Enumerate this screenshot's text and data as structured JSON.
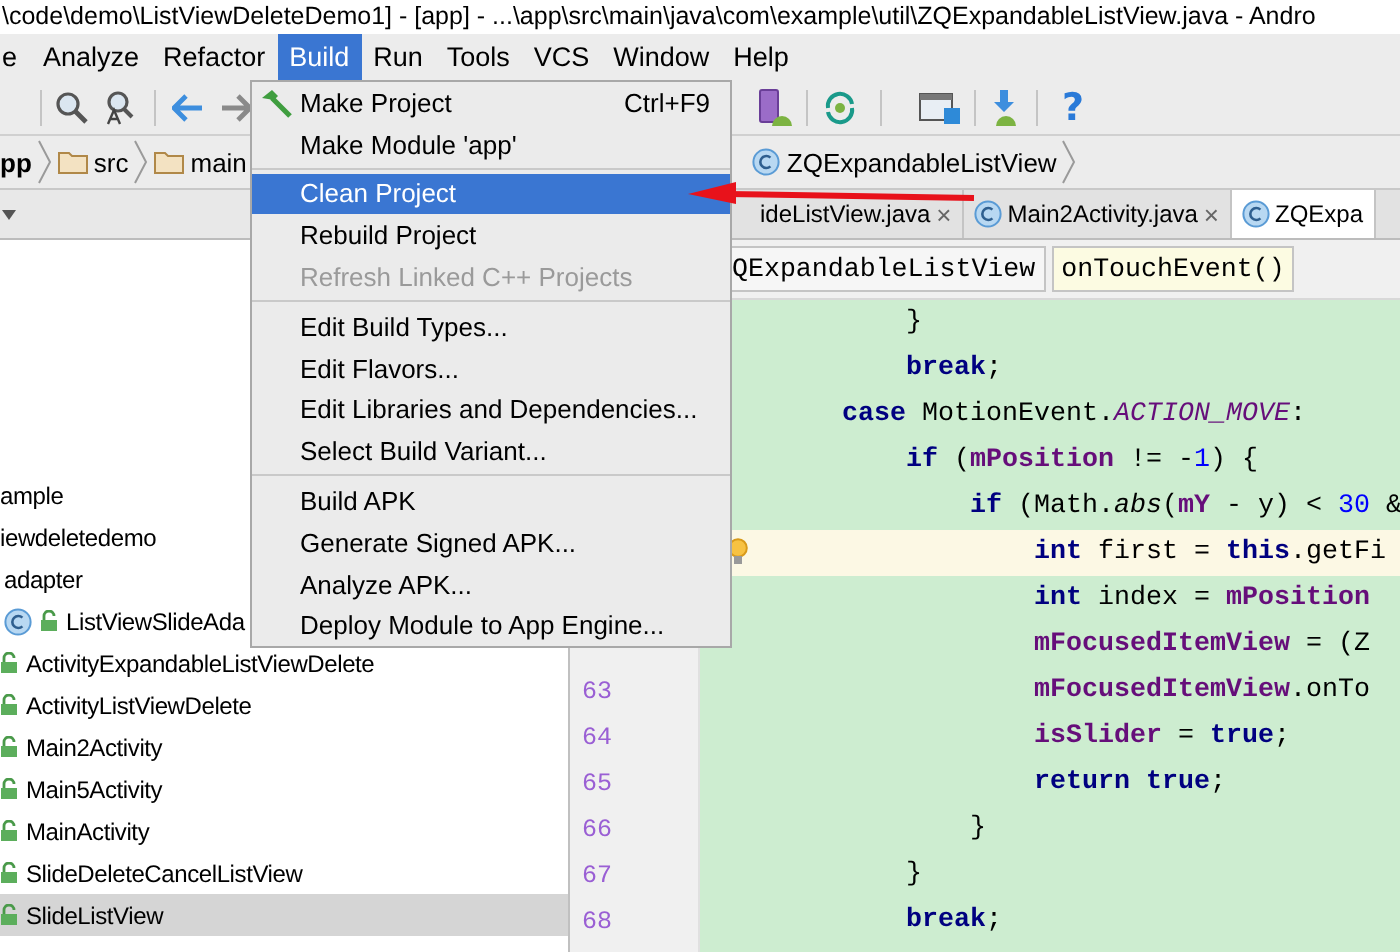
{
  "window": {
    "title": "\\code\\demo\\ListViewDeleteDemo1] - [app] - ...\\app\\src\\main\\java\\com\\example\\util\\ZQExpandableListView.java - Andro"
  },
  "menu_bar": [
    {
      "label": "e",
      "selected": false
    },
    {
      "label": "Analyze",
      "selected": false
    },
    {
      "label": "Refactor",
      "selected": false
    },
    {
      "label": "Build",
      "selected": true
    },
    {
      "label": "Run",
      "selected": false
    },
    {
      "label": "Tools",
      "selected": false
    },
    {
      "label": "VCS",
      "selected": false
    },
    {
      "label": "Window",
      "selected": false
    },
    {
      "label": "Help",
      "selected": false
    }
  ],
  "toolbar": {
    "help": "?"
  },
  "nav_bar": {
    "items": [
      {
        "label": "pp",
        "kind": "module"
      },
      {
        "label": "src",
        "kind": "folder"
      },
      {
        "label": "main",
        "kind": "folder"
      }
    ],
    "file": "ZQExpandableListView"
  },
  "editor_tabs": [
    {
      "label": "ideListView.java",
      "close": "×",
      "selected": false
    },
    {
      "label": "Main2Activity.java",
      "close": "×",
      "selected": false
    },
    {
      "label": "ZQExpa",
      "selected": true
    }
  ],
  "project_tree": [
    {
      "label": "ample",
      "kind": "package",
      "selected": false,
      "children": [
        {
          "label": "iewdeletedemo",
          "kind": "package",
          "selected": false,
          "children": [
            {
              "label": "adapter",
              "kind": "package",
              "selected": false,
              "children": [
                {
                  "label": "ListViewSlideAda",
                  "kind": "class",
                  "selected": false
                }
              ]
            },
            {
              "label": "ActivityExpandableListViewDelete",
              "kind": "class",
              "selected": false
            },
            {
              "label": "ActivityListViewDelete",
              "kind": "class",
              "selected": false
            },
            {
              "label": "Main2Activity",
              "kind": "class",
              "selected": false
            },
            {
              "label": "Main5Activity",
              "kind": "class",
              "selected": false
            },
            {
              "label": "MainActivity",
              "kind": "class",
              "selected": false
            },
            {
              "label": "SlideDeleteCancelListView",
              "kind": "class",
              "selected": false
            },
            {
              "label": "SlideListView",
              "kind": "class",
              "selected": true
            }
          ]
        }
      ]
    }
  ],
  "editor": {
    "breadcrumbs": [
      {
        "label": "QExpandableListView",
        "selected": false
      },
      {
        "label": "onTouchEvent()",
        "selected": true
      }
    ],
    "lines": [
      {
        "current": false,
        "tokens": [
          {
            "text": "        }",
            "kind": "plain"
          }
        ]
      },
      {
        "current": false,
        "tokens": [
          {
            "text": "        break",
            "kind": "keyword"
          },
          {
            "text": ";",
            "kind": "plain"
          }
        ]
      },
      {
        "current": false,
        "tokens": [
          {
            "text": "    case",
            "kind": "keyword"
          },
          {
            "text": " MotionEvent.",
            "kind": "plain"
          },
          {
            "text": "ACTION_MOVE",
            "kind": "constant"
          },
          {
            "text": ":",
            "kind": "plain"
          }
        ]
      },
      {
        "current": false,
        "tokens": [
          {
            "text": "        if",
            "kind": "keyword"
          },
          {
            "text": " (",
            "kind": "plain"
          },
          {
            "text": "mPosition",
            "kind": "field"
          },
          {
            "text": " != -",
            "kind": "plain"
          },
          {
            "text": "1",
            "kind": "number"
          },
          {
            "text": ") {",
            "kind": "plain"
          }
        ]
      },
      {
        "current": false,
        "tokens": [
          {
            "text": "            if",
            "kind": "keyword"
          },
          {
            "text": " (Math.",
            "kind": "plain"
          },
          {
            "text": "abs",
            "kind": "static_method"
          },
          {
            "text": "(",
            "kind": "plain"
          },
          {
            "text": "mY",
            "kind": "field"
          },
          {
            "text": " - y) < ",
            "kind": "plain"
          },
          {
            "text": "30",
            "kind": "number"
          },
          {
            "text": " &",
            "kind": "plain"
          }
        ]
      },
      {
        "current": true,
        "tokens": [
          {
            "text": "                int",
            "kind": "keyword"
          },
          {
            "text": " first = ",
            "kind": "plain"
          },
          {
            "text": "this",
            "kind": "keyword"
          },
          {
            "text": ".getFi",
            "kind": "plain"
          }
        ]
      },
      {
        "current": false,
        "tokens": [
          {
            "text": "                int",
            "kind": "keyword"
          },
          {
            "text": " index = ",
            "kind": "plain"
          },
          {
            "text": "mPosition",
            "kind": "field"
          }
        ]
      },
      {
        "current": false,
        "tokens": [
          {
            "text": "                mFocusedItemView",
            "kind": "field"
          },
          {
            "text": " = (Z",
            "kind": "plain"
          }
        ]
      },
      {
        "number": "63",
        "current": false,
        "tokens": [
          {
            "text": "                mFocusedItemView",
            "kind": "field"
          },
          {
            "text": ".onTo",
            "kind": "plain"
          }
        ]
      },
      {
        "number": "64",
        "current": false,
        "tokens": [
          {
            "text": "                isSlider",
            "kind": "field"
          },
          {
            "text": " = ",
            "kind": "plain"
          },
          {
            "text": "true",
            "kind": "keyword"
          },
          {
            "text": ";",
            "kind": "plain"
          }
        ]
      },
      {
        "number": "65",
        "current": false,
        "tokens": [
          {
            "text": "                return true",
            "kind": "keyword"
          },
          {
            "text": ";",
            "kind": "plain"
          }
        ]
      },
      {
        "number": "66",
        "current": false,
        "tokens": [
          {
            "text": "            }",
            "kind": "plain"
          }
        ]
      },
      {
        "number": "67",
        "current": false,
        "tokens": [
          {
            "text": "        }",
            "kind": "plain"
          }
        ]
      },
      {
        "number": "68",
        "current": false,
        "tokens": [
          {
            "text": "        break",
            "kind": "keyword"
          },
          {
            "text": ";",
            "kind": "plain"
          }
        ]
      }
    ]
  },
  "build_menu": [
    {
      "kind": "item",
      "label": "Make Project",
      "shortcut": "Ctrl+F9",
      "has_icon": true,
      "selected": false,
      "disabled": false
    },
    {
      "kind": "item",
      "label": "Make Module 'app'",
      "selected": false,
      "disabled": false
    },
    {
      "kind": "separator"
    },
    {
      "kind": "item",
      "label": "Clean Project",
      "selected": true,
      "disabled": false
    },
    {
      "kind": "item",
      "label": "Rebuild Project",
      "selected": false,
      "disabled": false
    },
    {
      "kind": "item",
      "label": "Refresh Linked C++ Projects",
      "selected": false,
      "disabled": true
    },
    {
      "kind": "separator"
    },
    {
      "kind": "item",
      "label": "Edit Build Types...",
      "selected": false,
      "disabled": false
    },
    {
      "kind": "item",
      "label": "Edit Flavors...",
      "selected": false,
      "disabled": false
    },
    {
      "kind": "item",
      "label": "Edit Libraries and Dependencies...",
      "selected": false,
      "disabled": false
    },
    {
      "kind": "item",
      "label": "Select Build Variant...",
      "selected": false,
      "disabled": false
    },
    {
      "kind": "separator"
    },
    {
      "kind": "item",
      "label": "Build APK",
      "selected": false,
      "disabled": false
    },
    {
      "kind": "item",
      "label": "Generate Signed APK...",
      "selected": false,
      "disabled": false
    },
    {
      "kind": "item",
      "label": "Analyze APK...",
      "selected": false,
      "disabled": false
    },
    {
      "kind": "item",
      "label": "Deploy Module to App Engine...",
      "selected": false,
      "disabled": false
    }
  ]
}
